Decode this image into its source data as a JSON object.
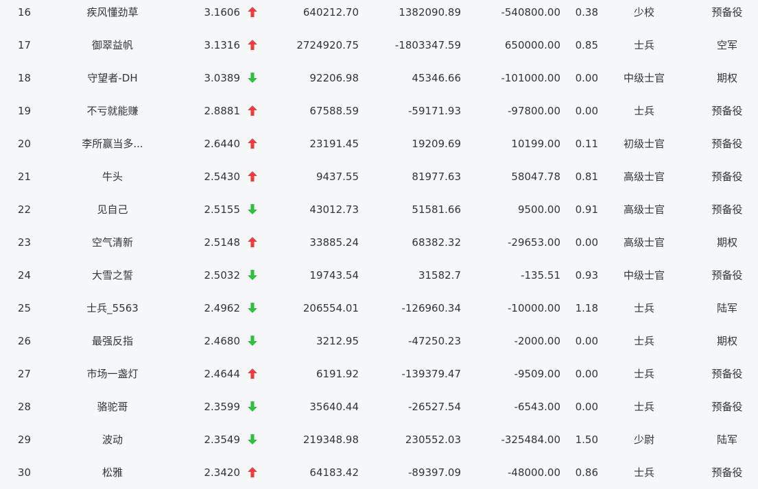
{
  "colors": {
    "up": "#ef3b3b",
    "down": "#2fbf41",
    "text": "#333333",
    "background": "#f6f7f9"
  },
  "rows": [
    {
      "rank": "16",
      "name": "疾风懂劲草",
      "score": "3.1606",
      "trend": "up",
      "v1": "640212.70",
      "v2": "1382090.89",
      "v3": "-540800.00",
      "v4": "0.38",
      "level": "少校",
      "category": "预备役"
    },
    {
      "rank": "17",
      "name": "御翠益帆",
      "score": "3.1316",
      "trend": "up",
      "v1": "2724920.75",
      "v2": "-1803347.59",
      "v3": "650000.00",
      "v4": "0.85",
      "level": "士兵",
      "category": "空军"
    },
    {
      "rank": "18",
      "name": "守望者-DH",
      "score": "3.0389",
      "trend": "down",
      "v1": "92206.98",
      "v2": "45346.66",
      "v3": "-101000.00",
      "v4": "0.00",
      "level": "中级士官",
      "category": "期权"
    },
    {
      "rank": "19",
      "name": "不亏就能赚",
      "score": "2.8881",
      "trend": "up",
      "v1": "67588.59",
      "v2": "-59171.93",
      "v3": "-97800.00",
      "v4": "0.00",
      "level": "士兵",
      "category": "预备役"
    },
    {
      "rank": "20",
      "name": "李所赢当多...",
      "score": "2.6440",
      "trend": "up",
      "v1": "23191.45",
      "v2": "19209.69",
      "v3": "10199.00",
      "v4": "0.11",
      "level": "初级士官",
      "category": "预备役"
    },
    {
      "rank": "21",
      "name": "牛头",
      "score": "2.5430",
      "trend": "up",
      "v1": "9437.55",
      "v2": "81977.63",
      "v3": "58047.78",
      "v4": "0.81",
      "level": "高级士官",
      "category": "预备役"
    },
    {
      "rank": "22",
      "name": "见自己",
      "score": "2.5155",
      "trend": "down",
      "v1": "43012.73",
      "v2": "51581.66",
      "v3": "9500.00",
      "v4": "0.91",
      "level": "高级士官",
      "category": "预备役"
    },
    {
      "rank": "23",
      "name": "空气清新",
      "score": "2.5148",
      "trend": "up",
      "v1": "33885.24",
      "v2": "68382.32",
      "v3": "-29653.00",
      "v4": "0.00",
      "level": "高级士官",
      "category": "期权"
    },
    {
      "rank": "24",
      "name": "大雪之誓",
      "score": "2.5032",
      "trend": "down",
      "v1": "19743.54",
      "v2": "31582.7",
      "v3": "-135.51",
      "v4": "0.93",
      "level": "中级士官",
      "category": "预备役"
    },
    {
      "rank": "25",
      "name": "士兵_5563",
      "score": "2.4962",
      "trend": "down",
      "v1": "206554.01",
      "v2": "-126960.34",
      "v3": "-10000.00",
      "v4": "1.18",
      "level": "士兵",
      "category": "陆军"
    },
    {
      "rank": "26",
      "name": "最强反指",
      "score": "2.4680",
      "trend": "down",
      "v1": "3212.95",
      "v2": "-47250.23",
      "v3": "-2000.00",
      "v4": "0.00",
      "level": "士兵",
      "category": "期权"
    },
    {
      "rank": "27",
      "name": "市场一盏灯",
      "score": "2.4644",
      "trend": "up",
      "v1": "6191.92",
      "v2": "-139379.47",
      "v3": "-9509.00",
      "v4": "0.00",
      "level": "士兵",
      "category": "预备役"
    },
    {
      "rank": "28",
      "name": "骆驼哥",
      "score": "2.3599",
      "trend": "down",
      "v1": "35640.44",
      "v2": "-26527.54",
      "v3": "-6543.00",
      "v4": "0.00",
      "level": "士兵",
      "category": "预备役"
    },
    {
      "rank": "29",
      "name": "波动",
      "score": "2.3549",
      "trend": "down",
      "v1": "219348.98",
      "v2": "230552.03",
      "v3": "-325484.00",
      "v4": "1.50",
      "level": "少尉",
      "category": "陆军"
    },
    {
      "rank": "30",
      "name": "松雅",
      "score": "2.3420",
      "trend": "up",
      "v1": "64183.42",
      "v2": "-89397.09",
      "v3": "-48000.00",
      "v4": "0.86",
      "level": "士兵",
      "category": "预备役"
    }
  ]
}
